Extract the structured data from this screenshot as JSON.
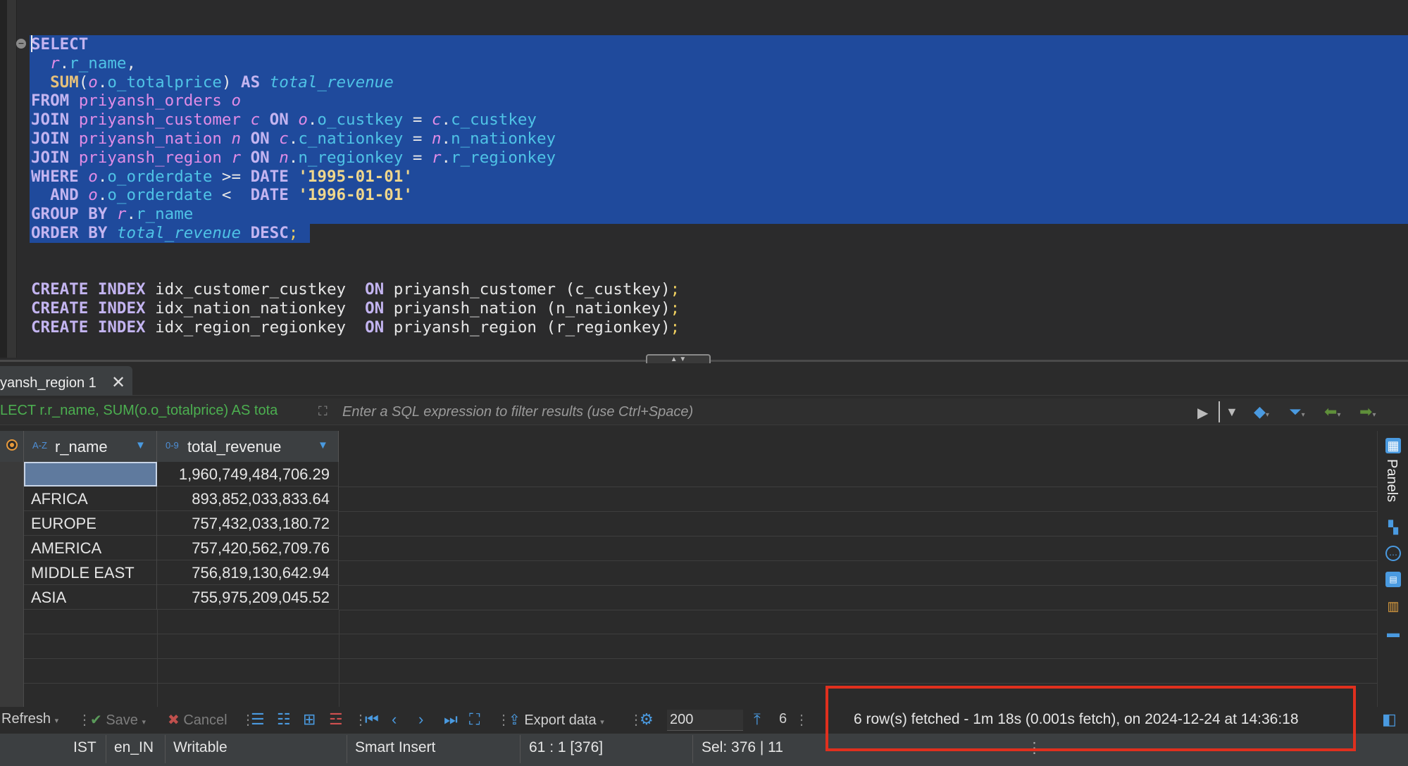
{
  "editor": {
    "sql_lines": [
      [
        [
          "kw",
          "SELECT"
        ]
      ],
      [
        [
          "pn",
          "  "
        ],
        [
          "al",
          "r"
        ],
        [
          "pn",
          "."
        ],
        [
          "col",
          "r_name"
        ],
        [
          "pn",
          ","
        ]
      ],
      [
        [
          "pn",
          "  "
        ],
        [
          "fn",
          "SUM"
        ],
        [
          "pn",
          "("
        ],
        [
          "al",
          "o"
        ],
        [
          "pn",
          "."
        ],
        [
          "col",
          "o_totalprice"
        ],
        [
          "pn",
          ") "
        ],
        [
          "kw",
          "AS"
        ],
        [
          "pn",
          " "
        ],
        [
          "al2",
          "total_revenue"
        ]
      ],
      [
        [
          "kw",
          "FROM"
        ],
        [
          "pn",
          " "
        ],
        [
          "id",
          "priyansh_orders"
        ],
        [
          "pn",
          " "
        ],
        [
          "al",
          "o"
        ]
      ],
      [
        [
          "kw",
          "JOIN"
        ],
        [
          "pn",
          " "
        ],
        [
          "id",
          "priyansh_customer"
        ],
        [
          "pn",
          " "
        ],
        [
          "al",
          "c"
        ],
        [
          "pn",
          " "
        ],
        [
          "kw",
          "ON"
        ],
        [
          "pn",
          " "
        ],
        [
          "al",
          "o"
        ],
        [
          "pn",
          "."
        ],
        [
          "col",
          "o_custkey"
        ],
        [
          "pn",
          " = "
        ],
        [
          "al",
          "c"
        ],
        [
          "pn",
          "."
        ],
        [
          "col",
          "c_custkey"
        ]
      ],
      [
        [
          "kw",
          "JOIN"
        ],
        [
          "pn",
          " "
        ],
        [
          "id",
          "priyansh_nation"
        ],
        [
          "pn",
          " "
        ],
        [
          "al",
          "n"
        ],
        [
          "pn",
          " "
        ],
        [
          "kw",
          "ON"
        ],
        [
          "pn",
          " "
        ],
        [
          "al",
          "c"
        ],
        [
          "pn",
          "."
        ],
        [
          "col",
          "c_nationkey"
        ],
        [
          "pn",
          " = "
        ],
        [
          "al",
          "n"
        ],
        [
          "pn",
          "."
        ],
        [
          "col",
          "n_nationkey"
        ]
      ],
      [
        [
          "kw",
          "JOIN"
        ],
        [
          "pn",
          " "
        ],
        [
          "id",
          "priyansh_region"
        ],
        [
          "pn",
          " "
        ],
        [
          "al",
          "r"
        ],
        [
          "pn",
          " "
        ],
        [
          "kw",
          "ON"
        ],
        [
          "pn",
          " "
        ],
        [
          "al",
          "n"
        ],
        [
          "pn",
          "."
        ],
        [
          "col",
          "n_regionkey"
        ],
        [
          "pn",
          " = "
        ],
        [
          "al",
          "r"
        ],
        [
          "pn",
          "."
        ],
        [
          "col",
          "r_regionkey"
        ]
      ],
      [
        [
          "kw",
          "WHERE"
        ],
        [
          "pn",
          " "
        ],
        [
          "al",
          "o"
        ],
        [
          "pn",
          "."
        ],
        [
          "col",
          "o_orderdate"
        ],
        [
          "pn",
          " >= "
        ],
        [
          "kw",
          "DATE"
        ],
        [
          "pn",
          " "
        ],
        [
          "str",
          "'1995-01-01'"
        ]
      ],
      [
        [
          "pn",
          "  "
        ],
        [
          "kw",
          "AND"
        ],
        [
          "pn",
          " "
        ],
        [
          "al",
          "o"
        ],
        [
          "pn",
          "."
        ],
        [
          "col",
          "o_orderdate"
        ],
        [
          "pn",
          " <  "
        ],
        [
          "kw",
          "DATE"
        ],
        [
          "pn",
          " "
        ],
        [
          "str",
          "'1996-01-01'"
        ]
      ],
      [
        [
          "kw",
          "GROUP BY"
        ],
        [
          "pn",
          " "
        ],
        [
          "al",
          "r"
        ],
        [
          "pn",
          "."
        ],
        [
          "col",
          "r_name"
        ]
      ],
      [
        [
          "kw",
          "ORDER BY"
        ],
        [
          "pn",
          " "
        ],
        [
          "al2",
          "total_revenue"
        ],
        [
          "pn",
          " "
        ],
        [
          "kw",
          "DESC"
        ],
        [
          "semi",
          ";"
        ]
      ],
      [],
      [],
      [
        [
          "kw",
          "CREATE INDEX"
        ],
        [
          "pn",
          " "
        ],
        [
          "id2",
          "idx_customer_custkey"
        ],
        [
          "pn",
          "  "
        ],
        [
          "kw",
          "ON"
        ],
        [
          "pn",
          " "
        ],
        [
          "id2",
          "priyansh_customer"
        ],
        [
          "pn",
          " ("
        ],
        [
          "id2",
          "c_custkey"
        ],
        [
          "pn",
          ")"
        ],
        [
          "semi",
          ";"
        ]
      ],
      [
        [
          "kw",
          "CREATE INDEX"
        ],
        [
          "pn",
          " "
        ],
        [
          "id2",
          "idx_nation_nationkey"
        ],
        [
          "pn",
          "  "
        ],
        [
          "kw",
          "ON"
        ],
        [
          "pn",
          " "
        ],
        [
          "id2",
          "priyansh_nation"
        ],
        [
          "pn",
          " ("
        ],
        [
          "id2",
          "n_nationkey"
        ],
        [
          "pn",
          ")"
        ],
        [
          "semi",
          ";"
        ]
      ],
      [
        [
          "kw",
          "CREATE INDEX"
        ],
        [
          "pn",
          " "
        ],
        [
          "id2",
          "idx_region_regionkey"
        ],
        [
          "pn",
          "  "
        ],
        [
          "kw",
          "ON"
        ],
        [
          "pn",
          " "
        ],
        [
          "id2",
          "priyansh_region"
        ],
        [
          "pn",
          " ("
        ],
        [
          "id2",
          "r_regionkey"
        ],
        [
          "pn",
          ")"
        ],
        [
          "semi",
          ";"
        ]
      ]
    ]
  },
  "results": {
    "tab_label": "yansh_region 1",
    "query_snippet": "LECT r.r_name, SUM(o.o_totalprice) AS tota",
    "filter_placeholder": "Enter a SQL expression to filter results (use Ctrl+Space)",
    "columns": [
      {
        "type": "A-Z",
        "name": "r_name"
      },
      {
        "type": "0-9",
        "name": "total_revenue"
      }
    ],
    "rows": [
      [
        "",
        "1,960,749,484,706.29"
      ],
      [
        "AFRICA",
        "893,852,033,833.64"
      ],
      [
        "EUROPE",
        "757,432,033,180.72"
      ],
      [
        "AMERICA",
        "757,420,562,709.76"
      ],
      [
        "MIDDLE EAST",
        "756,819,130,642.94"
      ],
      [
        "ASIA",
        "755,975,209,045.52"
      ]
    ]
  },
  "side_panel": {
    "label": "Panels"
  },
  "toolbar": {
    "refresh": "Refresh",
    "save": "Save",
    "cancel": "Cancel",
    "export": "Export data",
    "fetch_size": "200",
    "row_count": "6",
    "status": "6 row(s) fetched - 1m 18s (0.001s fetch), on 2024-12-24 at 14:36:18"
  },
  "statusbar": {
    "timezone": "IST",
    "locale": "en_IN",
    "mode": "Writable",
    "insert_mode": "Smart Insert",
    "position": "61 : 1 [376]",
    "selection": "Sel: 376 | 11"
  },
  "colors": {
    "highlight_box": "#e0301e",
    "selection": "#1f4a9c",
    "accent": "#4a9ae0"
  }
}
